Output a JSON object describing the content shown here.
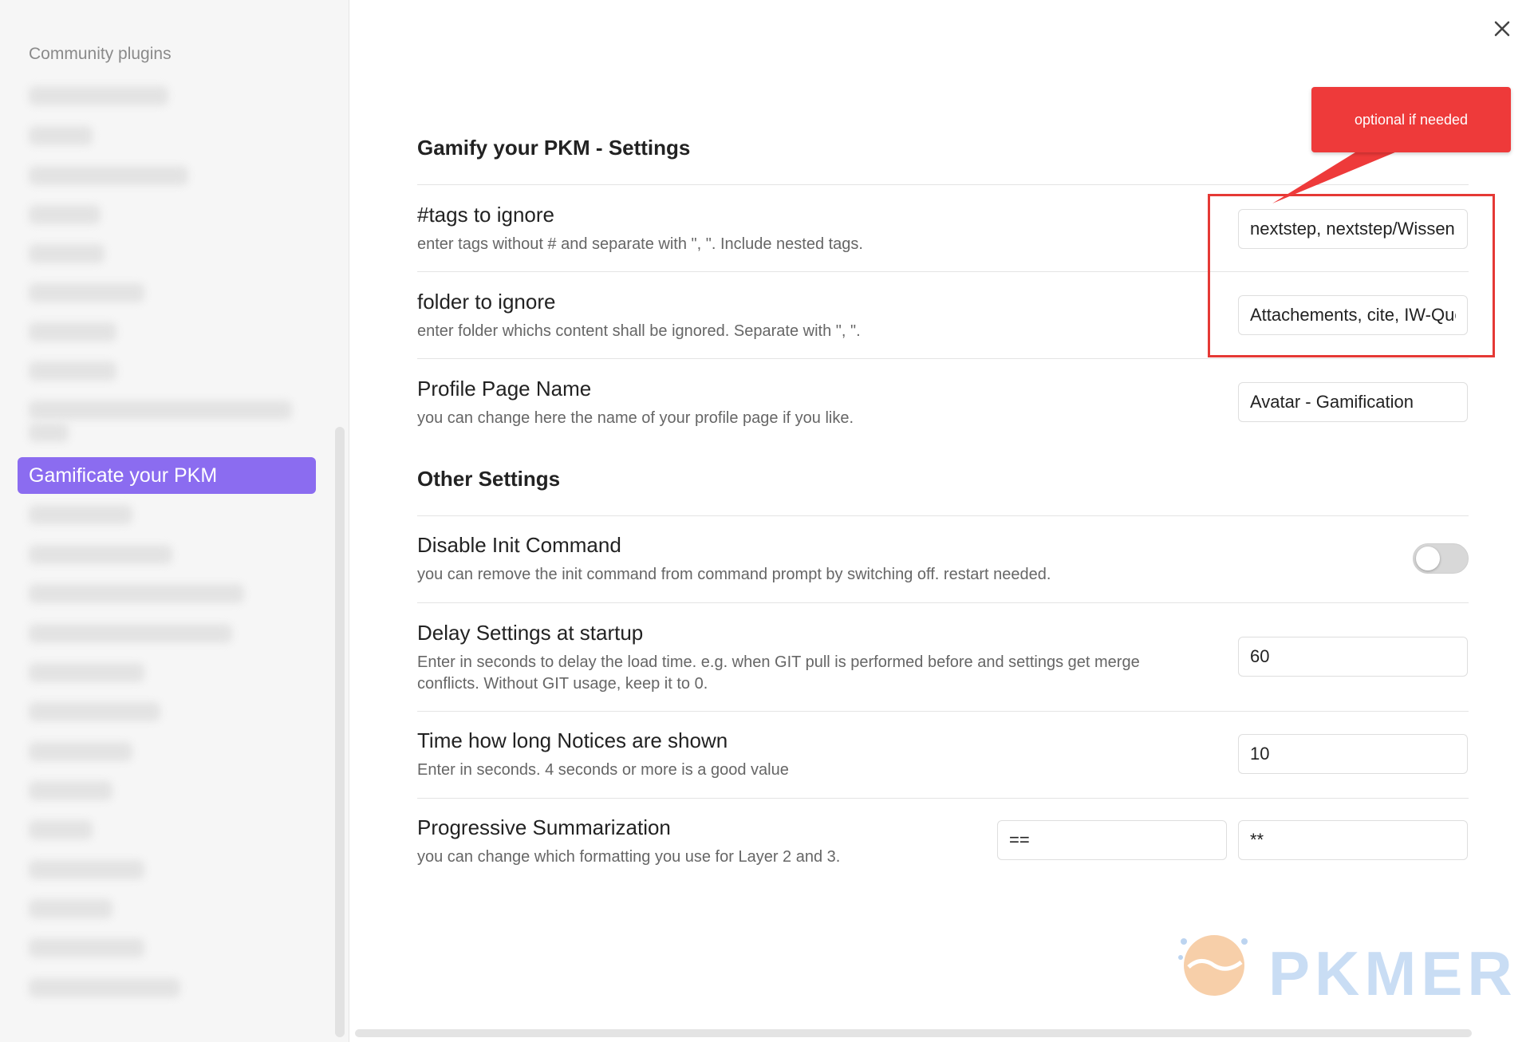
{
  "sidebar": {
    "heading": "Community plugins",
    "active_item": "Gamificate your PKM"
  },
  "close_icon": "close-icon",
  "annotation": {
    "callout_text": "optional if needed",
    "color": "#ee3a3a"
  },
  "main": {
    "section1_title": "Gamify your PKM - Settings",
    "tags": {
      "name": "#tags to ignore",
      "desc": "enter tags without # and separate with \", \". Include nested tags.",
      "value": "nextstep, nextstep/Wissen"
    },
    "folder": {
      "name": "folder to ignore",
      "desc": "enter folder whichs content shall be ignored. Separate with \", \".",
      "value": "Attachements, cite, IW-Queue"
    },
    "profile": {
      "name": "Profile Page Name",
      "desc": "you can change here the name of your profile page if you like.",
      "value": "Avatar - Gamification"
    },
    "section2_title": "Other Settings",
    "disable_init": {
      "name": "Disable Init Command",
      "desc": "you can remove the init command from command prompt by switching off. restart needed.",
      "enabled": false
    },
    "delay": {
      "name": "Delay Settings at startup",
      "desc": "Enter in seconds to delay the load time. e.g. when GIT pull is performed before and settings get merge conflicts. Without GIT usage, keep it to 0.",
      "value": "60"
    },
    "notices": {
      "name": "Time how long Notices are shown",
      "desc": "Enter in seconds. 4 seconds or more is a good value",
      "value": "10"
    },
    "progressive": {
      "name": "Progressive Summarization",
      "desc": "you can change which formatting you use for Layer 2 and 3.",
      "value_layer2": "==",
      "value_layer3": "**"
    }
  },
  "watermark": {
    "text": "PKMER"
  },
  "colors": {
    "accent": "#8b6cf0",
    "annotation": "#e53935"
  }
}
